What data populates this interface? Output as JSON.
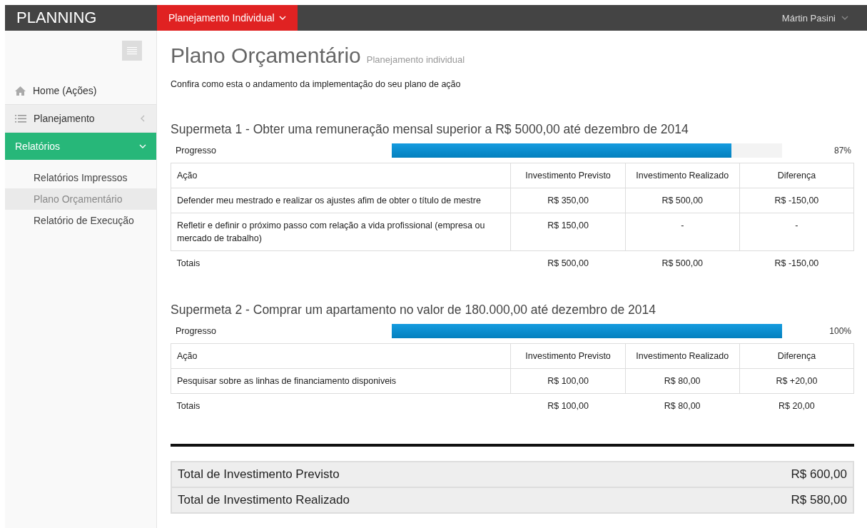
{
  "header": {
    "brand": "PLANNING",
    "menu": {
      "label": "Planejamento Individual",
      "selected": true
    },
    "user": "Mártin Pasini"
  },
  "sidebar": {
    "items": [
      {
        "label": "Home (Ações)",
        "selected": false
      },
      {
        "label": "Planejamento",
        "expanded": false,
        "selected": false
      },
      {
        "label": "Relatórios",
        "expanded": true,
        "selected": true,
        "children": [
          {
            "label": "Relatórios Impressos",
            "selected": false
          },
          {
            "label": "Plano Orçamentário",
            "selected": true
          },
          {
            "label": "Relatório de Execução",
            "selected": false
          }
        ]
      }
    ]
  },
  "page": {
    "title": "Plano Orçamentário",
    "subtitle": "Planejamento individual",
    "intro": "Confira como esta o andamento da implementação do seu plano de ação"
  },
  "goals": [
    {
      "title": "Supermeta 1 - Obter uma remuneração mensal superior a R$ 5000,00 até dezembro de 2014",
      "progress_label": "Progresso",
      "level": 0.87,
      "reading": "87%",
      "columns": [
        "Ação",
        "Investimento Previsto",
        "Investimento Realizado",
        "Diferença"
      ],
      "rows": [
        [
          "Defender meu mestrado e realizar os ajustes afim de obter o título de mestre",
          "R$ 350,00",
          "R$ 500,00",
          "R$ -150,00"
        ],
        [
          "Refletir e definir o próximo passo com relação a vida profissional (empresa ou mercado de trabalho)",
          "R$ 150,00",
          "-",
          "-"
        ]
      ],
      "totals": [
        "Totais",
        "R$ 500,00",
        "R$ 500,00",
        "R$ -150,00"
      ]
    },
    {
      "title": "Supermeta 2 - Comprar um apartamento no valor de 180.000,00 até dezembro de 2014",
      "progress_label": "Progresso",
      "level": 1,
      "reading": "100%",
      "columns": [
        "Ação",
        "Investimento Previsto",
        "Investimento Realizado",
        "Diferença"
      ],
      "rows": [
        [
          "Pesquisar sobre as linhas de financiamento disponiveis",
          "R$ 100,00",
          "R$ 80,00",
          "R$ +20,00"
        ]
      ],
      "totals": [
        "Totais",
        "R$ 100,00",
        "R$ 80,00",
        "R$ 20,00"
      ]
    }
  ],
  "summary": [
    {
      "label": "Total de Investimento Previsto",
      "value": "R$ 600,00"
    },
    {
      "label": "Total de Investimento Realizado",
      "value": "R$ 580,00"
    }
  ]
}
